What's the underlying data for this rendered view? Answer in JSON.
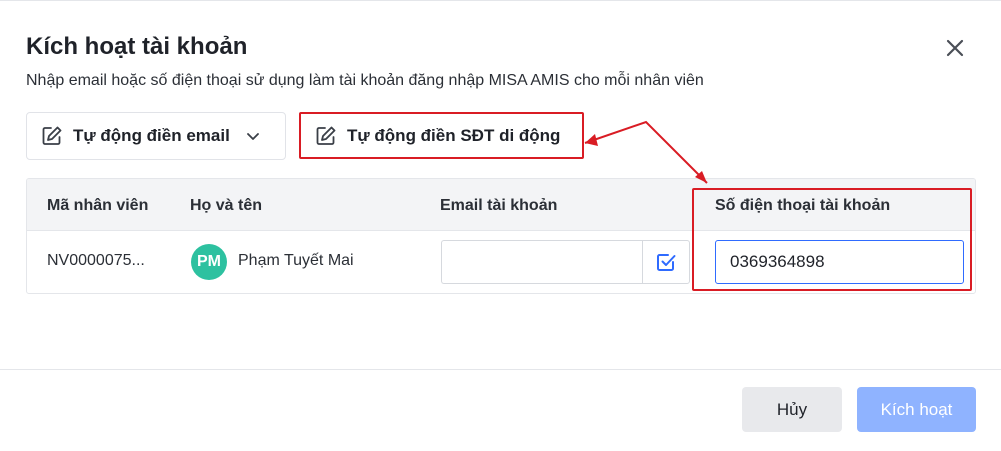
{
  "dialog": {
    "title": "Kích hoạt tài khoản",
    "subtitle": "Nhập email hoặc số điện thoại sử dụng làm tài khoản đăng nhập MISA AMIS cho mỗi nhân viên"
  },
  "toolbar": {
    "auto_email_label": "Tự động điền email",
    "auto_phone_label": "Tự động điền SĐT di động"
  },
  "table": {
    "headers": [
      "Mã nhân viên",
      "Họ và tên",
      "Email tài khoản",
      "Số điện thoại tài khoản"
    ],
    "rows": [
      {
        "employee_code": "NV0000075...",
        "avatar_initials": "PM",
        "full_name": "Phạm Tuyết Mai",
        "email": "",
        "phone": "0369364898"
      }
    ]
  },
  "footer": {
    "cancel_label": "Hủy",
    "activate_label": "Kích hoạt"
  },
  "colors": {
    "accent": "#2f6bff",
    "primary_disabled": "#8fb3ff",
    "avatar": "#2dc1a0",
    "annotation": "#d91c24"
  },
  "icons": {
    "close": "close-icon",
    "edit": "pencil-edit-icon",
    "dropdown": "chevron-down-icon",
    "check": "checkbox-checked-icon"
  }
}
